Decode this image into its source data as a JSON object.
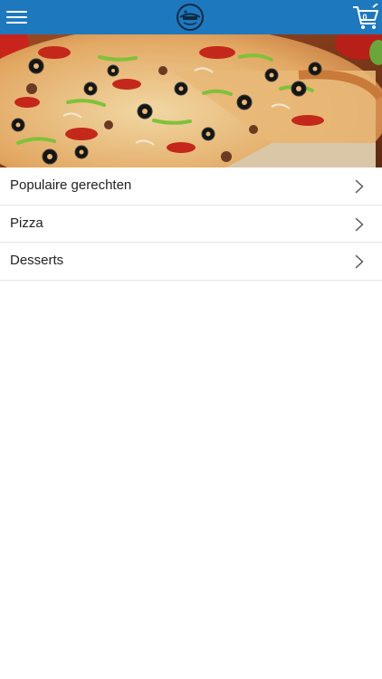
{
  "header": {
    "menu_icon": "hamburger-menu-icon",
    "logo_icon": "restaurant-logo",
    "cart_icon": "shopping-cart-icon",
    "cart_count": "0",
    "background_color": "#1e78be"
  },
  "hero": {
    "image": "pizza-photo"
  },
  "categories": [
    {
      "label": "Populaire gerechten",
      "icon": "chevron-right-icon"
    },
    {
      "label": "Pizza",
      "icon": "chevron-right-icon"
    },
    {
      "label": "Desserts",
      "icon": "chevron-right-icon"
    }
  ]
}
